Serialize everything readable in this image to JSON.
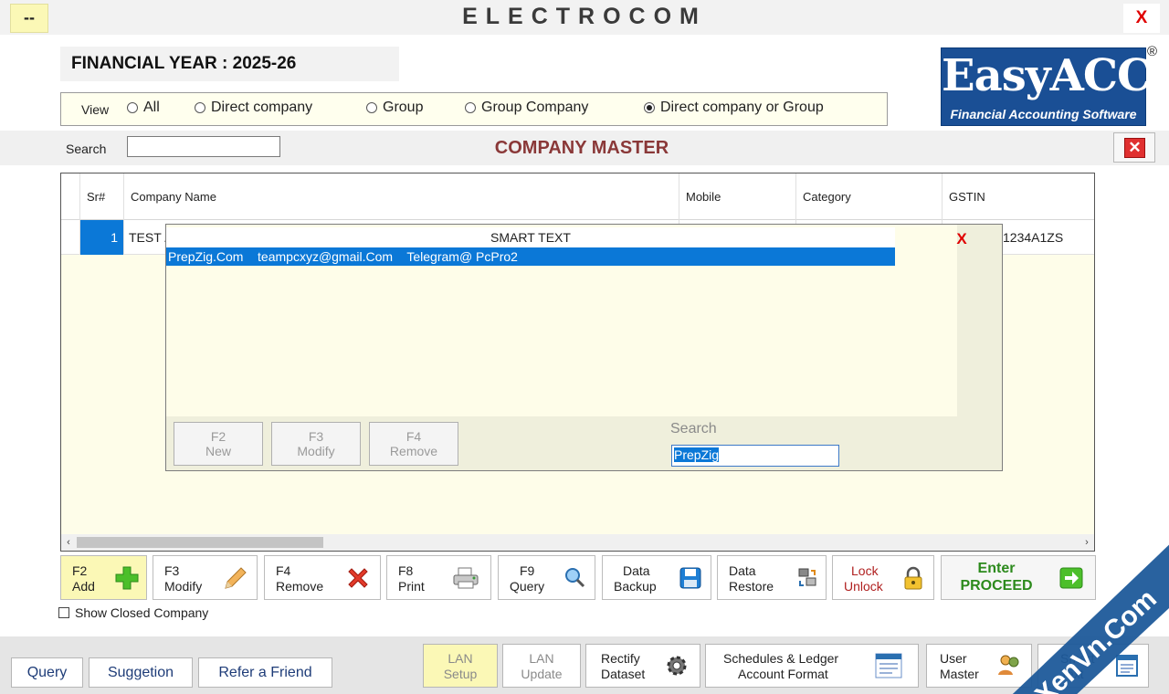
{
  "window": {
    "menu_btn": "--",
    "title": "ELECTROCOM",
    "close": "X"
  },
  "financial_year": "FINANCIAL YEAR : 2025-26",
  "view": {
    "label": "View",
    "options": [
      "All",
      "Direct company",
      "Group",
      "Group Company",
      "Direct company or Group"
    ],
    "selected": "Direct company or Group"
  },
  "logo": {
    "main": "EasyACC",
    "sub": "Financial Accounting Software",
    "reg": "®"
  },
  "search": {
    "label": "Search",
    "value": ""
  },
  "page_title": "COMPANY MASTER",
  "grid": {
    "columns": [
      "Sr#",
      "Company Name",
      "Mobile",
      "Category",
      "GSTIN"
    ],
    "rows": [
      {
        "sr": "1",
        "name": "TEST /",
        "mobile": "",
        "category": "",
        "gstin": "1234A1ZS"
      }
    ]
  },
  "popup": {
    "title": "SMART TEXT",
    "close": "X",
    "items": [
      "PrepZig.Com    teampcxyz@gmail.Com    Telegram@ PcPro2"
    ],
    "buttons": [
      {
        "key": "F2",
        "label": "New"
      },
      {
        "key": "F3",
        "label": "Modify"
      },
      {
        "key": "F4",
        "label": "Remove"
      }
    ],
    "search_label": "Search",
    "search_value": "PrepZig"
  },
  "actions": {
    "add": {
      "key": "F2",
      "label": "Add"
    },
    "modify": {
      "key": "F3",
      "label": "Modify"
    },
    "remove": {
      "key": "F4",
      "label": "Remove"
    },
    "print": {
      "key": "F8",
      "label": "Print"
    },
    "query": {
      "key": "F9",
      "label": "Query"
    },
    "backup": {
      "key": "Data",
      "label": "Backup"
    },
    "restore": {
      "key": "Data",
      "label": "Restore"
    },
    "lock": {
      "key": "Lock",
      "label": "Unlock"
    },
    "enter": {
      "key": "Enter",
      "label": "PROCEED"
    }
  },
  "show_closed": {
    "label": "Show Closed Company",
    "checked": false
  },
  "bottom": {
    "query": "Query",
    "suggestion": "Suggetion",
    "refer": "Refer a Friend",
    "lan_setup": [
      "LAN",
      "Setup"
    ],
    "lan_update": [
      "LAN",
      "Update"
    ],
    "rectify": [
      "Rectify",
      "Dataset"
    ],
    "schedules": [
      "Schedules & Ledger",
      "Account Format"
    ],
    "user_master": [
      "User",
      "Master"
    ],
    "smart_text": [
      "Smart",
      "Text"
    ]
  },
  "watermark": "XenVn.Com",
  "colors": {
    "accent": "#0b78d7",
    "title_red": "#8a3838",
    "grid_bg": "#fefde9",
    "highlight": "#fbf8b6"
  }
}
